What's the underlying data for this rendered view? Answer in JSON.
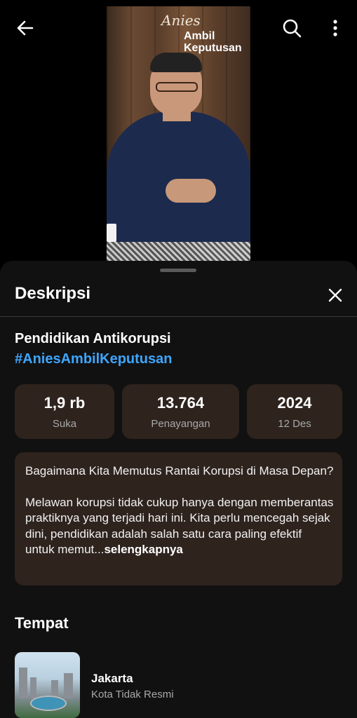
{
  "video": {
    "overlay_script": "Anies",
    "overlay_title_line1": "Ambil",
    "overlay_title_line2": "Keputusan"
  },
  "icons": {
    "back": "arrow-left-icon",
    "search": "search-icon",
    "more": "more-vertical-icon",
    "close": "close-icon"
  },
  "sheet": {
    "title": "Deskripsi",
    "video_title": "Pendidikan Antikorupsi",
    "hashtag": "#AniesAmbilKeputusan",
    "stats": {
      "likes": {
        "value": "1,9 rb",
        "label": "Suka"
      },
      "views": {
        "value": "13.764",
        "label": "Penayangan"
      },
      "date": {
        "value": "2024",
        "label": "12 Des"
      }
    },
    "description": {
      "paragraph1": "Bagaimana Kita Memutus Rantai Korupsi di Masa Depan?",
      "paragraph2": "Melawan korupsi tidak cukup hanya dengan memberantas praktiknya yang terjadi hari ini. Kita perlu mencegah sejak dini, pendidikan adalah salah satu cara paling efektif untuk memut...",
      "more": "selengkapnya"
    },
    "place": {
      "heading": "Tempat",
      "name": "Jakarta",
      "subtitle": "Kota Tidak Resmi"
    }
  },
  "colors": {
    "background": "#000000",
    "sheet": "#111111",
    "card": "#2e231d",
    "link": "#3ea6ff",
    "secondary_text": "#a9a9a9"
  }
}
